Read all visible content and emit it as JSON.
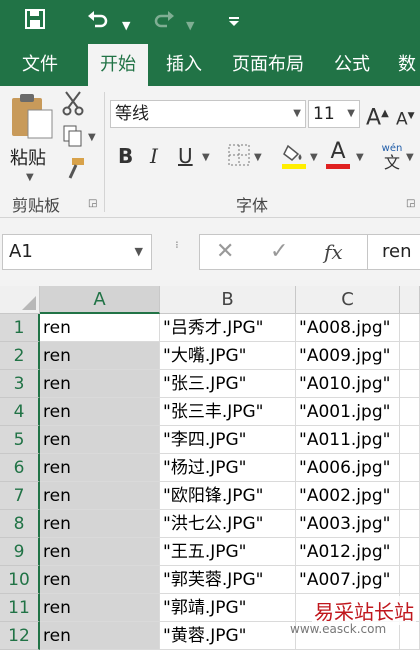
{
  "quick_access": {
    "save_icon": "save-icon",
    "undo_icon": "undo-icon",
    "redo_icon": "redo-icon",
    "customize_icon": "customize-icon"
  },
  "tabs": [
    "文件",
    "开始",
    "插入",
    "页面布局",
    "公式",
    "数"
  ],
  "active_tab": "开始",
  "ribbon": {
    "clipboard": {
      "paste_label": "粘贴",
      "group_label": "剪贴板"
    },
    "font": {
      "font_name": "等线",
      "font_size": "11",
      "group_label": "字体",
      "bold": "B",
      "italic": "I",
      "underline": "U",
      "font_color_letter": "A",
      "phonetic_top": "wén",
      "phonetic_bottom": "文"
    }
  },
  "formula_bar": {
    "name_box": "A1",
    "cancel": "✕",
    "enter": "✓",
    "fx": "fx",
    "value": "ren"
  },
  "columns": [
    "A",
    "B",
    "C"
  ],
  "rows": [
    {
      "num": "1",
      "a": "ren",
      "b": "\"吕秀才.JPG\"",
      "c": "\"A008.jpg\""
    },
    {
      "num": "2",
      "a": "ren",
      "b": "\"大嘴.JPG\"",
      "c": "\"A009.jpg\""
    },
    {
      "num": "3",
      "a": "ren",
      "b": "\"张三.JPG\"",
      "c": "\"A010.jpg\""
    },
    {
      "num": "4",
      "a": "ren",
      "b": "\"张三丰.JPG\"",
      "c": "\"A001.jpg\""
    },
    {
      "num": "5",
      "a": "ren",
      "b": "\"李四.JPG\"",
      "c": "\"A011.jpg\""
    },
    {
      "num": "6",
      "a": "ren",
      "b": "\"杨过.JPG\"",
      "c": "\"A006.jpg\""
    },
    {
      "num": "7",
      "a": "ren",
      "b": "\"欧阳锋.JPG\"",
      "c": "\"A002.jpg\""
    },
    {
      "num": "8",
      "a": "ren",
      "b": "\"洪七公.JPG\"",
      "c": "\"A003.jpg\""
    },
    {
      "num": "9",
      "a": "ren",
      "b": "\"王五.JPG\"",
      "c": "\"A012.jpg\""
    },
    {
      "num": "10",
      "a": "ren",
      "b": "\"郭芙蓉.JPG\"",
      "c": "\"A007.jpg\""
    },
    {
      "num": "11",
      "a": "ren",
      "b": "\"郭靖.JPG\"",
      "c": ""
    },
    {
      "num": "12",
      "a": "ren",
      "b": "\"黄蓉.JPG\"",
      "c": ""
    }
  ],
  "watermark": {
    "text": "易采站长站",
    "url": "www.easck.com"
  },
  "colors": {
    "accent": "#217346",
    "font_color": "#e02020",
    "highlight": "#ffee00"
  }
}
